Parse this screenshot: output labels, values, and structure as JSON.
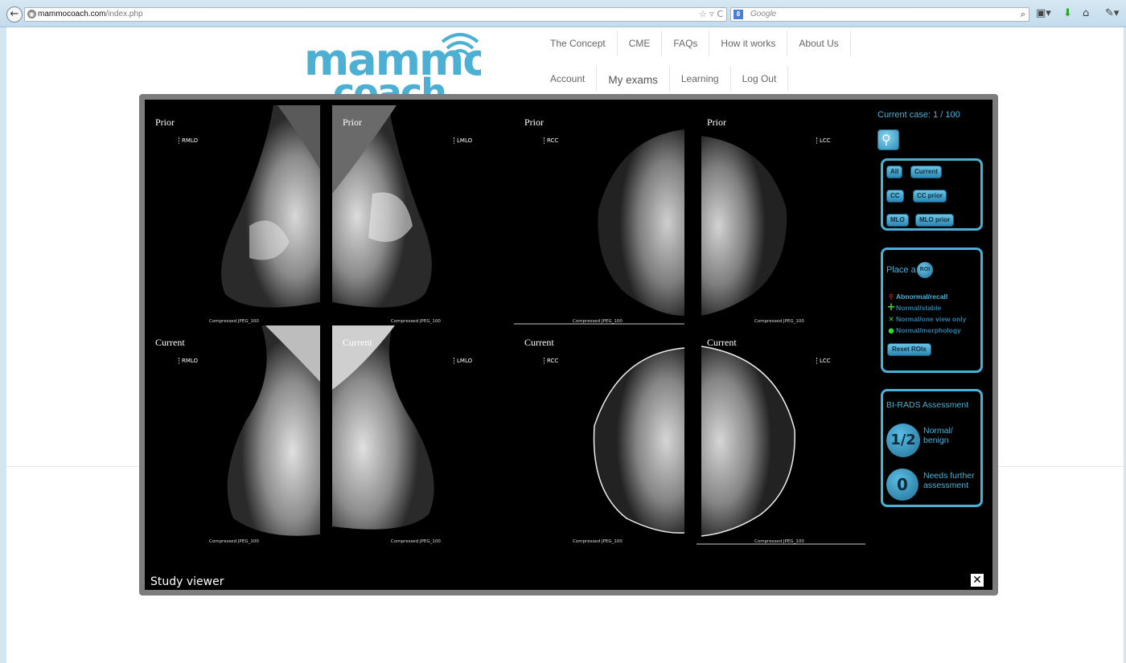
{
  "browser": {
    "url_host": "mammocoach.com",
    "url_path": "/index.php",
    "search_placeholder": "Google",
    "search_engine_badge": "8"
  },
  "site": {
    "logo_line1": "mammo",
    "logo_line2": "coach",
    "nav_row1": [
      "The Concept",
      "CME",
      "FAQs",
      "How it works",
      "About Us"
    ],
    "nav_row2": [
      "Account",
      "My exams",
      "Learning",
      "Log Out"
    ]
  },
  "viewer": {
    "title": "Study viewer",
    "close_icon": "close-icon",
    "current_case": "Current case: 1 / 100",
    "panels": [
      {
        "label": "Prior",
        "view": "RMLO",
        "compression": "Compressed JPEG_100"
      },
      {
        "label": "Prior",
        "view": "LMLO",
        "compression": "Compressed JPEG_100"
      },
      {
        "label": "Prior",
        "view": "RCC",
        "compression": "Compressed JPEG_100"
      },
      {
        "label": "Prior",
        "view": "LCC",
        "compression": "Compressed JPEG_100"
      },
      {
        "label": "Current",
        "view": "RMLO",
        "compression": "Compressed JPEG_100"
      },
      {
        "label": "Current",
        "view": "LMLO",
        "compression": "Compressed JPEG_100"
      },
      {
        "label": "Current",
        "view": "RCC",
        "compression": "Compressed JPEG_100"
      },
      {
        "label": "Current",
        "view": "LCC",
        "compression": "Compressed JPEG_100"
      }
    ],
    "layout_buttons": {
      "all": "All",
      "current": "Current",
      "cc": "CC",
      "cc_prior": "CC prior",
      "mlo": "MLO",
      "mlo_prior": "MLO prior"
    },
    "roi": {
      "place_text": "Place a",
      "roi_button": "ROI",
      "legend": [
        {
          "label": "Abnormal/recall",
          "mark": "⚲",
          "color": "#ff2a2a",
          "text_color": "#4bb0d3"
        },
        {
          "label": "Normal/stable",
          "mark": "+",
          "color": "#2ddc2d",
          "text_color": "#2a7fa8"
        },
        {
          "label": "Normal/one view only",
          "mark": "✕",
          "color": "#2ddc2d",
          "text_color": "#2a7fa8"
        },
        {
          "label": "Normal/morphology",
          "mark": "●",
          "color": "#2ddc2d",
          "text_color": "#2a7fa8"
        }
      ],
      "reset_button": "Reset ROIs"
    },
    "birads": {
      "title": "BI-RADS Assessment",
      "option1_value": "1/2",
      "option1_label": "Normal/ benign",
      "option2_value": "0",
      "option2_label": "Needs further assessment"
    }
  }
}
